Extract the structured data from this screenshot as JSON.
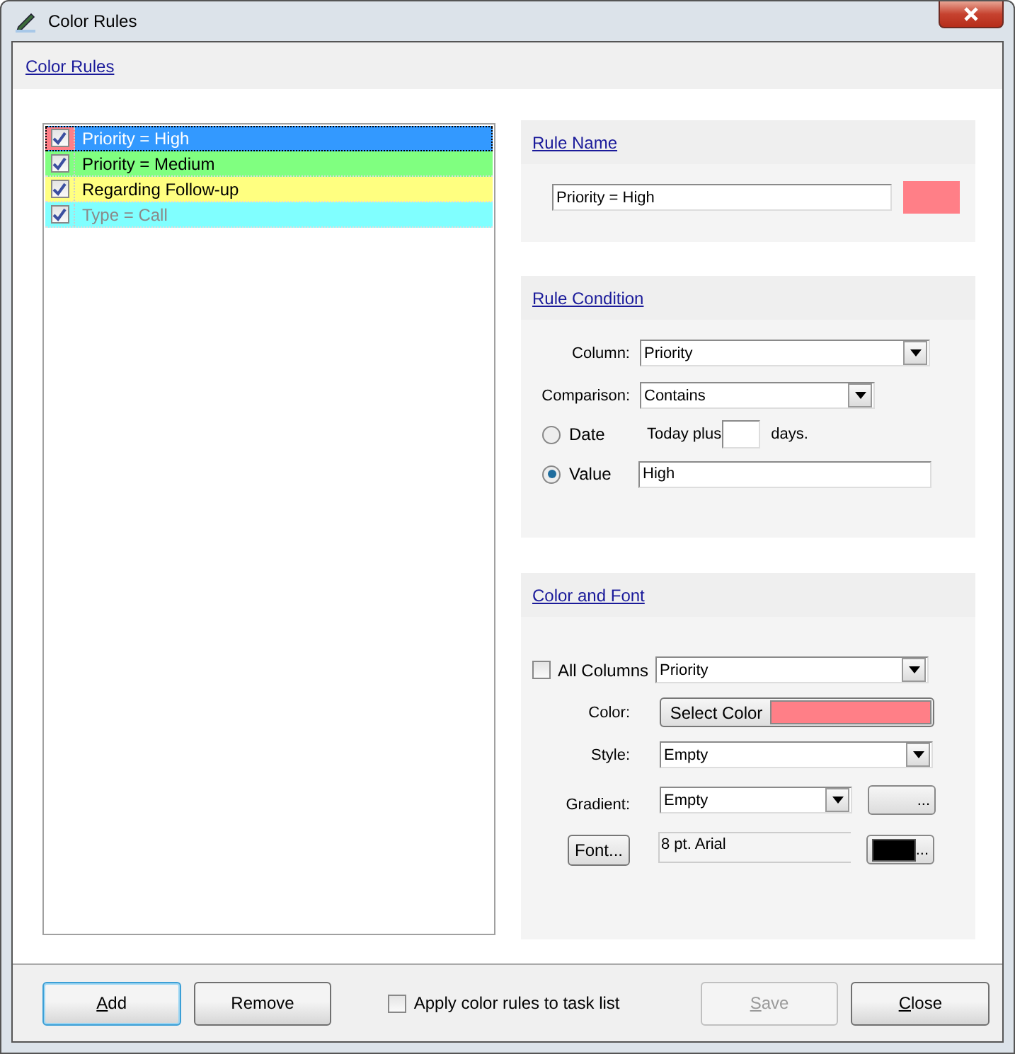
{
  "window": {
    "title": "Color Rules"
  },
  "header": {
    "title": "Color Rules"
  },
  "rules": [
    {
      "label": "Priority = High",
      "checked": true,
      "selected": true,
      "dimmed": false,
      "color": "#ff7f87"
    },
    {
      "label": "Priority = Medium",
      "checked": true,
      "selected": false,
      "dimmed": false,
      "color": "#80ff80"
    },
    {
      "label": "Regarding Follow-up",
      "checked": true,
      "selected": false,
      "dimmed": false,
      "color": "#ffff80"
    },
    {
      "label": "Type = Call",
      "checked": true,
      "selected": false,
      "dimmed": true,
      "color": "#80ffff"
    }
  ],
  "rule_name": {
    "heading": "Rule Name",
    "value": "Priority = High",
    "color": "#ff7f87"
  },
  "rule_condition": {
    "heading": "Rule Condition",
    "column_label": "Column:",
    "column_value": "Priority",
    "comparison_label": "Comparison:",
    "comparison_value": "Contains",
    "options": [
      {
        "label": "Date",
        "selected": false
      },
      {
        "label": "Value",
        "selected": true
      }
    ],
    "today_prefix": "Today plus",
    "days_suffix": "days.",
    "value": "High"
  },
  "color_font": {
    "heading": "Color and Font",
    "all_columns": {
      "label": "All Columns",
      "checked": false
    },
    "column_value": "Priority",
    "color_label": "Color:",
    "select_color": "Select Color",
    "color": "#ff7f87",
    "style_label": "Style:",
    "style_value": "Empty",
    "gradient_label": "Gradient:",
    "gradient_value": "Empty",
    "gradient_more": "...",
    "font_button": "Font...",
    "font_value": "8 pt. Arial",
    "font_swatch": {
      "color": "#000000"
    },
    "font_more": "..."
  },
  "footer": {
    "left_buttons": [
      {
        "label": "Add",
        "underline_first": true,
        "disabled": false,
        "focused": true
      },
      {
        "label": "Remove",
        "underline_first": false,
        "disabled": false,
        "focused": false
      }
    ],
    "apply": {
      "label": "Apply color rules to task list",
      "checked": false
    },
    "right_buttons": [
      {
        "label": "Save",
        "underline_first": true,
        "disabled": true,
        "focused": false
      },
      {
        "label": "Close",
        "underline_first": true,
        "disabled": false,
        "focused": false
      }
    ]
  }
}
